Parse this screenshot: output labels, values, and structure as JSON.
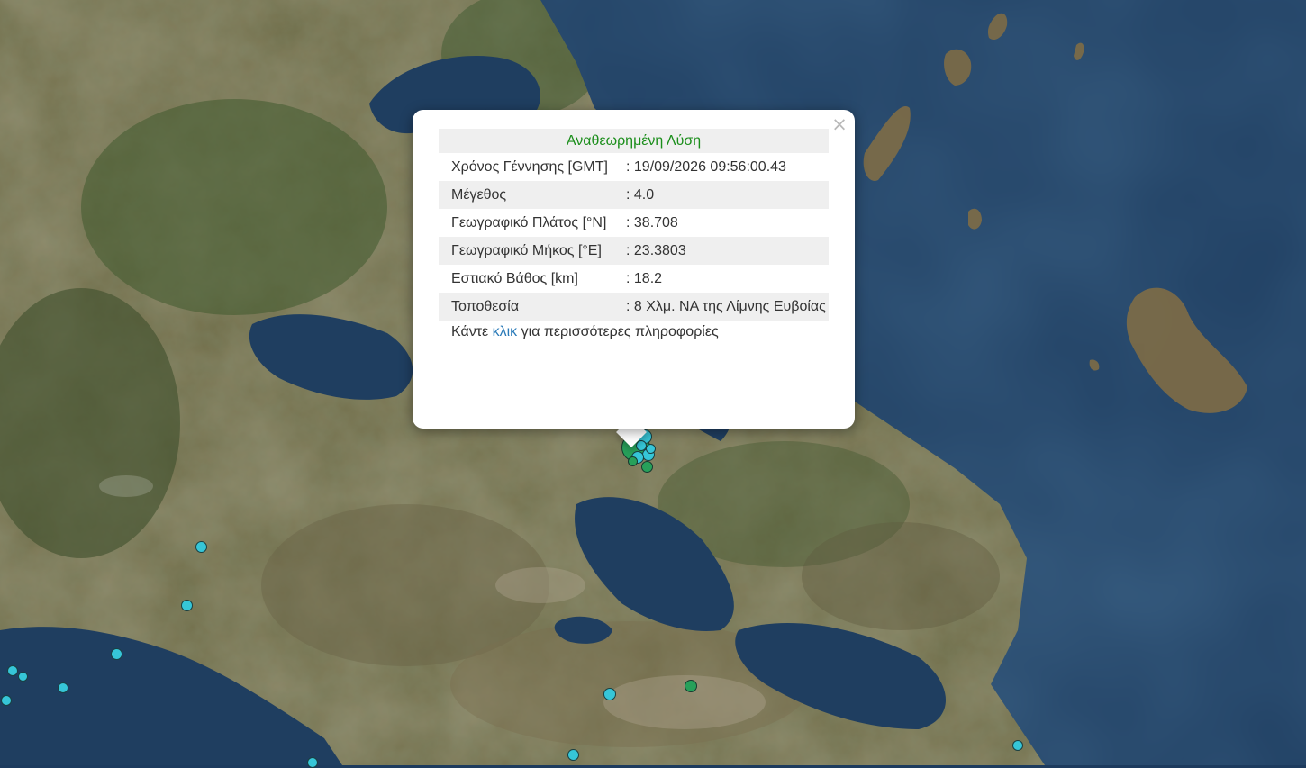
{
  "popup": {
    "title": "Αναθεωρημένη Λύση",
    "close_glyph": "×",
    "rows": [
      {
        "label": "Χρόνος Γέννησης [GMT]",
        "value": ": 19/09/2026 09:56:00.43"
      },
      {
        "label": "Μέγεθος",
        "value": ": 4.0"
      },
      {
        "label": "Γεωγραφικό Πλάτος [°N]",
        "value": ": 38.708"
      },
      {
        "label": "Γεωγραφικό Μήκος [°E]",
        "value": ": 23.3803"
      },
      {
        "label": "Εστιακό Βάθος [km]",
        "value": ": 18.2"
      },
      {
        "label": "Τοποθεσία",
        "value": ": 8 Χλμ. ΝΑ της Λίμνης Ευβοίας"
      }
    ],
    "footer_prefix": "Κάντε ",
    "footer_link": "κλικ",
    "footer_suffix": " για περισσότερες πληροφορίες"
  },
  "colors": {
    "marker_cyan": "#36c6d8",
    "marker_green": "#27a05a",
    "title_green": "#1b8e1b",
    "link_blue": "#2a7ab8",
    "sea": "#1d3b5e"
  }
}
